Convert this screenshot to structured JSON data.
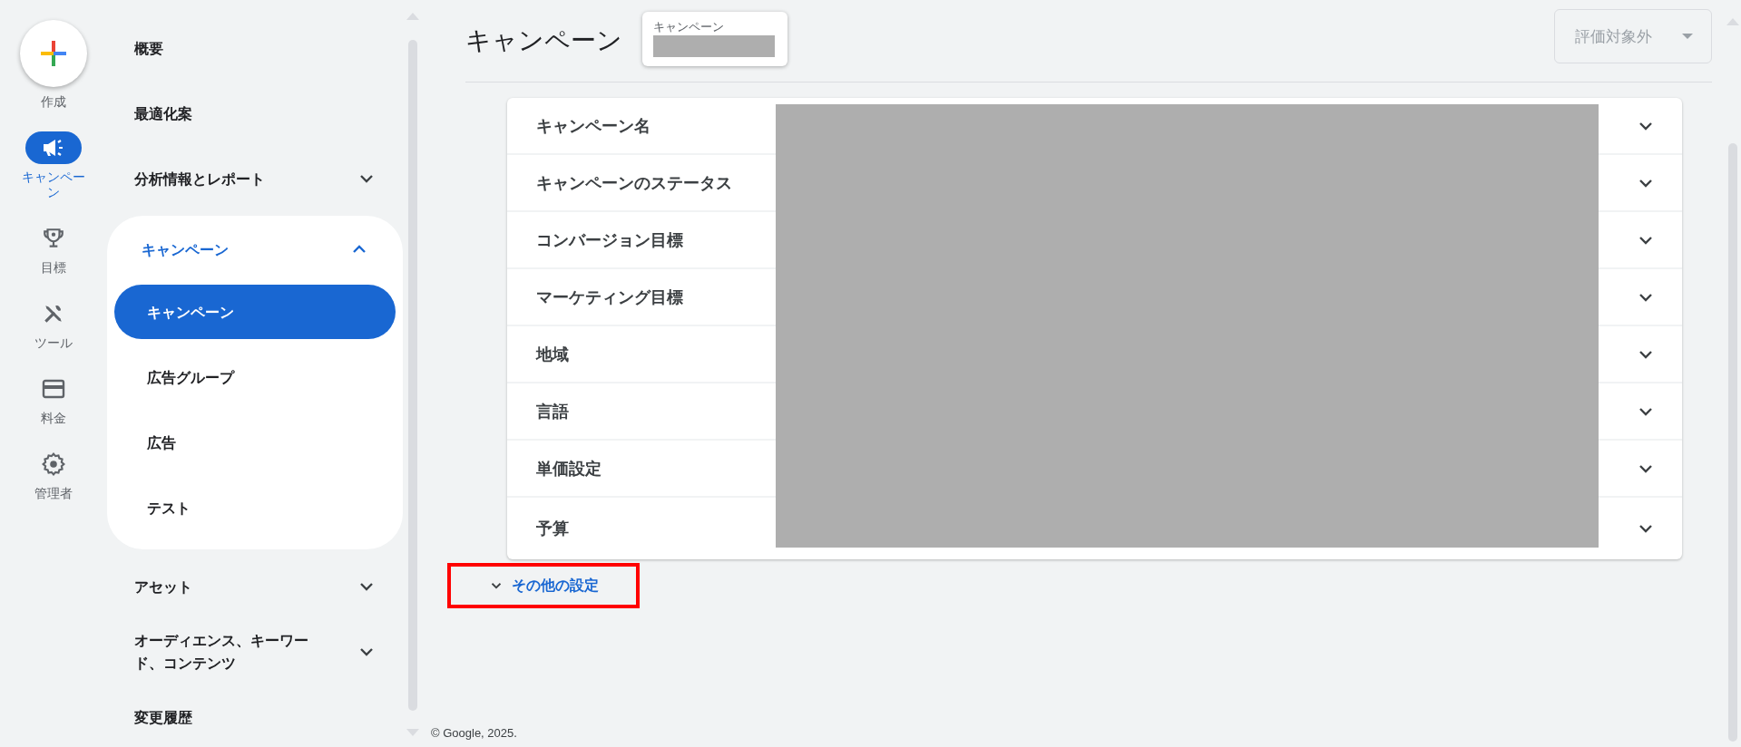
{
  "rail": [
    {
      "kind": "create",
      "label": "作成"
    },
    {
      "kind": "campaign",
      "label": "キャンペーン",
      "selected": true
    },
    {
      "kind": "goals",
      "label": "目標",
      "selected": false
    },
    {
      "kind": "tools",
      "label": "ツール",
      "selected": false
    },
    {
      "kind": "billing",
      "label": "料金",
      "selected": false
    },
    {
      "kind": "admin",
      "label": "管理者",
      "selected": false
    }
  ],
  "sidebar": {
    "items": [
      {
        "label": "概要",
        "selected": false
      },
      {
        "label": "最適化案",
        "selected": false
      },
      {
        "label": "分析情報とレポート",
        "selected": false,
        "expanded": false
      },
      {
        "label": "キャンペーン",
        "selected": false,
        "expanded": true,
        "children": [
          {
            "label": "キャンペーン",
            "selected": true
          },
          {
            "label": "広告グループ",
            "selected": false
          },
          {
            "label": "広告",
            "selected": false
          },
          {
            "label": "テスト",
            "selected": false
          }
        ]
      },
      {
        "label": "アセット",
        "selected": false,
        "expanded": false
      },
      {
        "label": "オーディエンス、キーワード、コンテンツ",
        "selected": false,
        "expanded": false
      },
      {
        "label": "変更履歴",
        "selected": false
      }
    ]
  },
  "header": {
    "title": "キャンペーン",
    "chip": {
      "label": "キャンペーン",
      "value_redacted": true
    },
    "dropdown": {
      "value": "評価対象外",
      "disabled": true
    }
  },
  "settings": {
    "values_redacted": true,
    "rows": [
      {
        "label": "キャンペーン名",
        "expanded": false
      },
      {
        "label": "キャンペーンのステータス",
        "expanded": false
      },
      {
        "label": "コンバージョン目標",
        "expanded": false
      },
      {
        "label": "マーケティング目標",
        "expanded": false
      },
      {
        "label": "地域",
        "expanded": false
      },
      {
        "label": "言語",
        "expanded": false
      },
      {
        "label": "単価設定",
        "expanded": false
      },
      {
        "label": "予算",
        "expanded": false
      }
    ]
  },
  "more_settings": {
    "label": "その他の設定",
    "highlighted": true
  },
  "footer": "© Google, 2025."
}
